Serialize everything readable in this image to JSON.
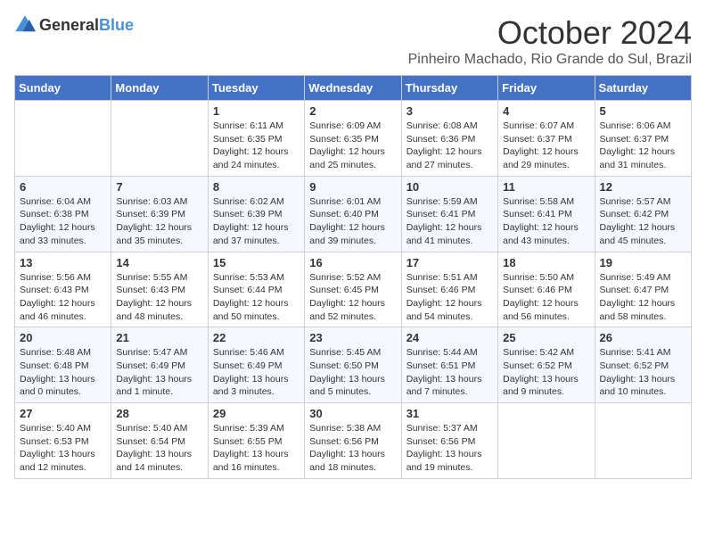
{
  "logo": {
    "general": "General",
    "blue": "Blue"
  },
  "title": "October 2024",
  "location": "Pinheiro Machado, Rio Grande do Sul, Brazil",
  "days_of_week": [
    "Sunday",
    "Monday",
    "Tuesday",
    "Wednesday",
    "Thursday",
    "Friday",
    "Saturday"
  ],
  "weeks": [
    [
      {
        "day": "",
        "info": ""
      },
      {
        "day": "",
        "info": ""
      },
      {
        "day": "1",
        "info": "Sunrise: 6:11 AM\nSunset: 6:35 PM\nDaylight: 12 hours and 24 minutes."
      },
      {
        "day": "2",
        "info": "Sunrise: 6:09 AM\nSunset: 6:35 PM\nDaylight: 12 hours and 25 minutes."
      },
      {
        "day": "3",
        "info": "Sunrise: 6:08 AM\nSunset: 6:36 PM\nDaylight: 12 hours and 27 minutes."
      },
      {
        "day": "4",
        "info": "Sunrise: 6:07 AM\nSunset: 6:37 PM\nDaylight: 12 hours and 29 minutes."
      },
      {
        "day": "5",
        "info": "Sunrise: 6:06 AM\nSunset: 6:37 PM\nDaylight: 12 hours and 31 minutes."
      }
    ],
    [
      {
        "day": "6",
        "info": "Sunrise: 6:04 AM\nSunset: 6:38 PM\nDaylight: 12 hours and 33 minutes."
      },
      {
        "day": "7",
        "info": "Sunrise: 6:03 AM\nSunset: 6:39 PM\nDaylight: 12 hours and 35 minutes."
      },
      {
        "day": "8",
        "info": "Sunrise: 6:02 AM\nSunset: 6:39 PM\nDaylight: 12 hours and 37 minutes."
      },
      {
        "day": "9",
        "info": "Sunrise: 6:01 AM\nSunset: 6:40 PM\nDaylight: 12 hours and 39 minutes."
      },
      {
        "day": "10",
        "info": "Sunrise: 5:59 AM\nSunset: 6:41 PM\nDaylight: 12 hours and 41 minutes."
      },
      {
        "day": "11",
        "info": "Sunrise: 5:58 AM\nSunset: 6:41 PM\nDaylight: 12 hours and 43 minutes."
      },
      {
        "day": "12",
        "info": "Sunrise: 5:57 AM\nSunset: 6:42 PM\nDaylight: 12 hours and 45 minutes."
      }
    ],
    [
      {
        "day": "13",
        "info": "Sunrise: 5:56 AM\nSunset: 6:43 PM\nDaylight: 12 hours and 46 minutes."
      },
      {
        "day": "14",
        "info": "Sunrise: 5:55 AM\nSunset: 6:43 PM\nDaylight: 12 hours and 48 minutes."
      },
      {
        "day": "15",
        "info": "Sunrise: 5:53 AM\nSunset: 6:44 PM\nDaylight: 12 hours and 50 minutes."
      },
      {
        "day": "16",
        "info": "Sunrise: 5:52 AM\nSunset: 6:45 PM\nDaylight: 12 hours and 52 minutes."
      },
      {
        "day": "17",
        "info": "Sunrise: 5:51 AM\nSunset: 6:46 PM\nDaylight: 12 hours and 54 minutes."
      },
      {
        "day": "18",
        "info": "Sunrise: 5:50 AM\nSunset: 6:46 PM\nDaylight: 12 hours and 56 minutes."
      },
      {
        "day": "19",
        "info": "Sunrise: 5:49 AM\nSunset: 6:47 PM\nDaylight: 12 hours and 58 minutes."
      }
    ],
    [
      {
        "day": "20",
        "info": "Sunrise: 5:48 AM\nSunset: 6:48 PM\nDaylight: 13 hours and 0 minutes."
      },
      {
        "day": "21",
        "info": "Sunrise: 5:47 AM\nSunset: 6:49 PM\nDaylight: 13 hours and 1 minute."
      },
      {
        "day": "22",
        "info": "Sunrise: 5:46 AM\nSunset: 6:49 PM\nDaylight: 13 hours and 3 minutes."
      },
      {
        "day": "23",
        "info": "Sunrise: 5:45 AM\nSunset: 6:50 PM\nDaylight: 13 hours and 5 minutes."
      },
      {
        "day": "24",
        "info": "Sunrise: 5:44 AM\nSunset: 6:51 PM\nDaylight: 13 hours and 7 minutes."
      },
      {
        "day": "25",
        "info": "Sunrise: 5:42 AM\nSunset: 6:52 PM\nDaylight: 13 hours and 9 minutes."
      },
      {
        "day": "26",
        "info": "Sunrise: 5:41 AM\nSunset: 6:52 PM\nDaylight: 13 hours and 10 minutes."
      }
    ],
    [
      {
        "day": "27",
        "info": "Sunrise: 5:40 AM\nSunset: 6:53 PM\nDaylight: 13 hours and 12 minutes."
      },
      {
        "day": "28",
        "info": "Sunrise: 5:40 AM\nSunset: 6:54 PM\nDaylight: 13 hours and 14 minutes."
      },
      {
        "day": "29",
        "info": "Sunrise: 5:39 AM\nSunset: 6:55 PM\nDaylight: 13 hours and 16 minutes."
      },
      {
        "day": "30",
        "info": "Sunrise: 5:38 AM\nSunset: 6:56 PM\nDaylight: 13 hours and 18 minutes."
      },
      {
        "day": "31",
        "info": "Sunrise: 5:37 AM\nSunset: 6:56 PM\nDaylight: 13 hours and 19 minutes."
      },
      {
        "day": "",
        "info": ""
      },
      {
        "day": "",
        "info": ""
      }
    ]
  ]
}
